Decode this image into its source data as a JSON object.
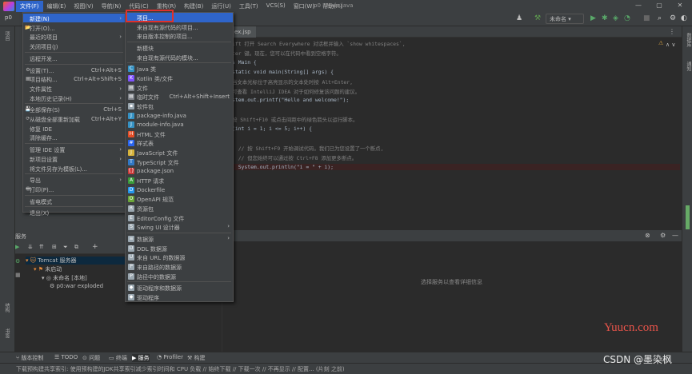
{
  "titlebar": {
    "project": "p0",
    "window_title": "p0 - Main.java",
    "menus": [
      "文件(F)",
      "编辑(E)",
      "视图(V)",
      "导航(N)",
      "代码(C)",
      "重构(R)",
      "构建(B)",
      "运行(U)",
      "工具(T)",
      "VCS(S)",
      "窗口(W)",
      "帮助(H)"
    ],
    "minimize": "—",
    "maximize": "▢",
    "close": "✕"
  },
  "toolbar": {
    "run_config": "未命名"
  },
  "editor": {
    "tab": "ex.jsp",
    "lines": [
      {
        "prefix": "ift 打开 Search Everywhere 对话框并输入 `show whitespaces`,",
        "type": "cmt"
      },
      {
        "prefix": "ter 键。现在，您可以在代码中看到空格字符。",
        "type": "cmt"
      },
      {
        "prefix": "s Main {",
        "type": "code"
      },
      {
        "prefix": "static void main(String[] args) {",
        "type": "code"
      },
      {
        "prefix": "当文本光标位于高亮显示的文本处时按 Alt+Enter,",
        "type": "cmt"
      },
      {
        "prefix": "可查看 IntelliJ IDEA 对于如何修复该问题的建议。",
        "type": "cmt"
      },
      {
        "prefix": "stem.out.printf(\"Hello and welcome!\");",
        "type": "code"
      },
      {
        "prefix": "",
        "type": "blank"
      },
      {
        "prefix": "按 Shift+F10 或点击间距中的绿色箭头以运行脚本。",
        "type": "cmt"
      },
      {
        "prefix": "(int i = 1; i <= 5; i++) {",
        "type": "code"
      },
      {
        "prefix": "",
        "type": "blank"
      },
      {
        "prefix": "  // 按 Shift+F9 开始调试代码。我们已为您设置了一个断点,",
        "type": "cmt"
      },
      {
        "prefix": "  // 但您始终可以通过按 Ctrl+F8 添加更多断点。",
        "type": "cmt"
      },
      {
        "prefix": "  System.out.println(\"i = \" + i);",
        "type": "code"
      }
    ]
  },
  "services": {
    "title": "服务",
    "tree": [
      {
        "label": "Tomcat 服务器",
        "level": 1
      },
      {
        "label": "未启动",
        "level": 2
      },
      {
        "label": "未命名 [本地]",
        "level": 3
      },
      {
        "label": "p0:war exploded",
        "level": 4
      }
    ],
    "empty_hint": "选择服务以查看详细信息"
  },
  "file_menu": {
    "items": [
      {
        "label": "新建(N)",
        "shortcut": "",
        "submenu": true,
        "selected": true
      },
      {
        "label": "打开(O)...",
        "shortcut": "",
        "submenu": false
      },
      {
        "label": "最近的项目",
        "shortcut": "",
        "submenu": true
      },
      {
        "label": "关闭项目(J)",
        "shortcut": "",
        "submenu": false
      },
      {
        "label": "",
        "separator": true
      },
      {
        "label": "远程开发...",
        "shortcut": "",
        "submenu": false
      },
      {
        "label": "",
        "separator": true
      },
      {
        "label": "设置(T)...",
        "shortcut": "Ctrl+Alt+S",
        "submenu": false
      },
      {
        "label": "项目结构...",
        "shortcut": "Ctrl+Alt+Shift+S",
        "submenu": false
      },
      {
        "label": "文件属性",
        "shortcut": "",
        "submenu": true
      },
      {
        "label": "本地历史记录(H)",
        "shortcut": "",
        "submenu": true
      },
      {
        "label": "",
        "separator": true
      },
      {
        "label": "全部保存(S)",
        "shortcut": "Ctrl+S",
        "submenu": false
      },
      {
        "label": "从磁盘全部重新加载",
        "shortcut": "Ctrl+Alt+Y",
        "submenu": false
      },
      {
        "label": "修复 IDE",
        "shortcut": "",
        "submenu": false
      },
      {
        "label": "清除缓存...",
        "shortcut": "",
        "submenu": false
      },
      {
        "label": "",
        "separator": true
      },
      {
        "label": "管理 IDE 设置",
        "shortcut": "",
        "submenu": true
      },
      {
        "label": "新项目设置",
        "shortcut": "",
        "submenu": true
      },
      {
        "label": "将文件另存为模板(L)...",
        "shortcut": "",
        "submenu": false
      },
      {
        "label": "",
        "separator": true
      },
      {
        "label": "导出",
        "shortcut": "",
        "submenu": true
      },
      {
        "label": "打印(P)...",
        "shortcut": "",
        "submenu": false
      },
      {
        "label": "",
        "separator": true
      },
      {
        "label": "省电模式",
        "shortcut": "",
        "submenu": false
      },
      {
        "label": "",
        "separator": true
      },
      {
        "label": "退出(X)",
        "shortcut": "",
        "submenu": false
      }
    ]
  },
  "new_submenu": {
    "items": [
      {
        "label": "项目...",
        "icon": "",
        "color": "",
        "selected": true
      },
      {
        "label": "来自现有源代码的项目...",
        "icon": "",
        "color": ""
      },
      {
        "label": "来自版本控制的项目...",
        "icon": "",
        "color": ""
      },
      {
        "separator": true
      },
      {
        "label": "新模块",
        "icon": "",
        "color": ""
      },
      {
        "label": "来自现有源代码的模块...",
        "icon": "",
        "color": ""
      },
      {
        "separator": true
      },
      {
        "label": "Java 类",
        "icon": "C",
        "color": "#3592c4"
      },
      {
        "label": "Kotlin 类/文件",
        "icon": "K",
        "color": "#7f52ff"
      },
      {
        "label": "文件",
        "icon": "▤",
        "color": "#7a7e85"
      },
      {
        "label": "临时文件",
        "icon": "▤",
        "color": "#7a7e85",
        "shortcut": "Ctrl+Alt+Shift+Insert"
      },
      {
        "label": "软件包",
        "icon": "▪",
        "color": "#9aa7b0"
      },
      {
        "label": "package-info.java",
        "icon": "J",
        "color": "#3592c4"
      },
      {
        "label": "module-info.java",
        "icon": "J",
        "color": "#3592c4"
      },
      {
        "label": "HTML 文件",
        "icon": "H",
        "color": "#e44d26"
      },
      {
        "label": "样式表",
        "icon": "#",
        "color": "#2965f1"
      },
      {
        "label": "JavaScript 文件",
        "icon": "J",
        "color": "#d6b33b"
      },
      {
        "label": "TypeScript 文件",
        "icon": "T",
        "color": "#3178c6"
      },
      {
        "label": "package.json",
        "icon": "{}",
        "color": "#cb3837"
      },
      {
        "label": "HTTP 请求",
        "icon": "A",
        "color": "#3a9c3a"
      },
      {
        "label": "Dockerfile",
        "icon": "D",
        "color": "#2496ed"
      },
      {
        "label": "OpenAPI 规范",
        "icon": "O",
        "color": "#6ba539"
      },
      {
        "label": "资源包",
        "icon": "R",
        "color": "#9aa7b0"
      },
      {
        "label": "EditorConfig 文件",
        "icon": "E",
        "color": "#9aa7b0"
      },
      {
        "label": "Swing UI 设计器",
        "icon": "S",
        "color": "#9aa7b0",
        "submenu": true
      },
      {
        "separator": true
      },
      {
        "label": "数据源",
        "icon": "≡",
        "color": "#9aa7b0",
        "submenu": true
      },
      {
        "label": "DDL 数据源",
        "icon": "D",
        "color": "#9aa7b0"
      },
      {
        "label": "来自 URL 的数据源",
        "icon": "U",
        "color": "#9aa7b0"
      },
      {
        "label": "来自路径的数据源",
        "icon": "P",
        "color": "#9aa7b0"
      },
      {
        "label": "路径中的数据源",
        "icon": "P",
        "color": "#9aa7b0"
      },
      {
        "separator": true
      },
      {
        "label": "驱动程序和数据源",
        "icon": "◆",
        "color": "#9aa7b0"
      },
      {
        "label": "驱动程序",
        "icon": "◆",
        "color": "#9aa7b0"
      }
    ]
  },
  "bottom_tabs": [
    "版本控制",
    "TODO",
    "问题",
    "终端",
    "服务",
    "Profiler",
    "构建"
  ],
  "status_text": "下载预构建共享索引: 使用预构建的JDK共享索引减少索引时间和 CPU 负载 // 始终下载 // 下载一次 // 不再显示 // 配置... (片刻 之前)",
  "watermarks": {
    "site": "Yuucn.com",
    "csdn": "CSDN @墨染枫"
  }
}
